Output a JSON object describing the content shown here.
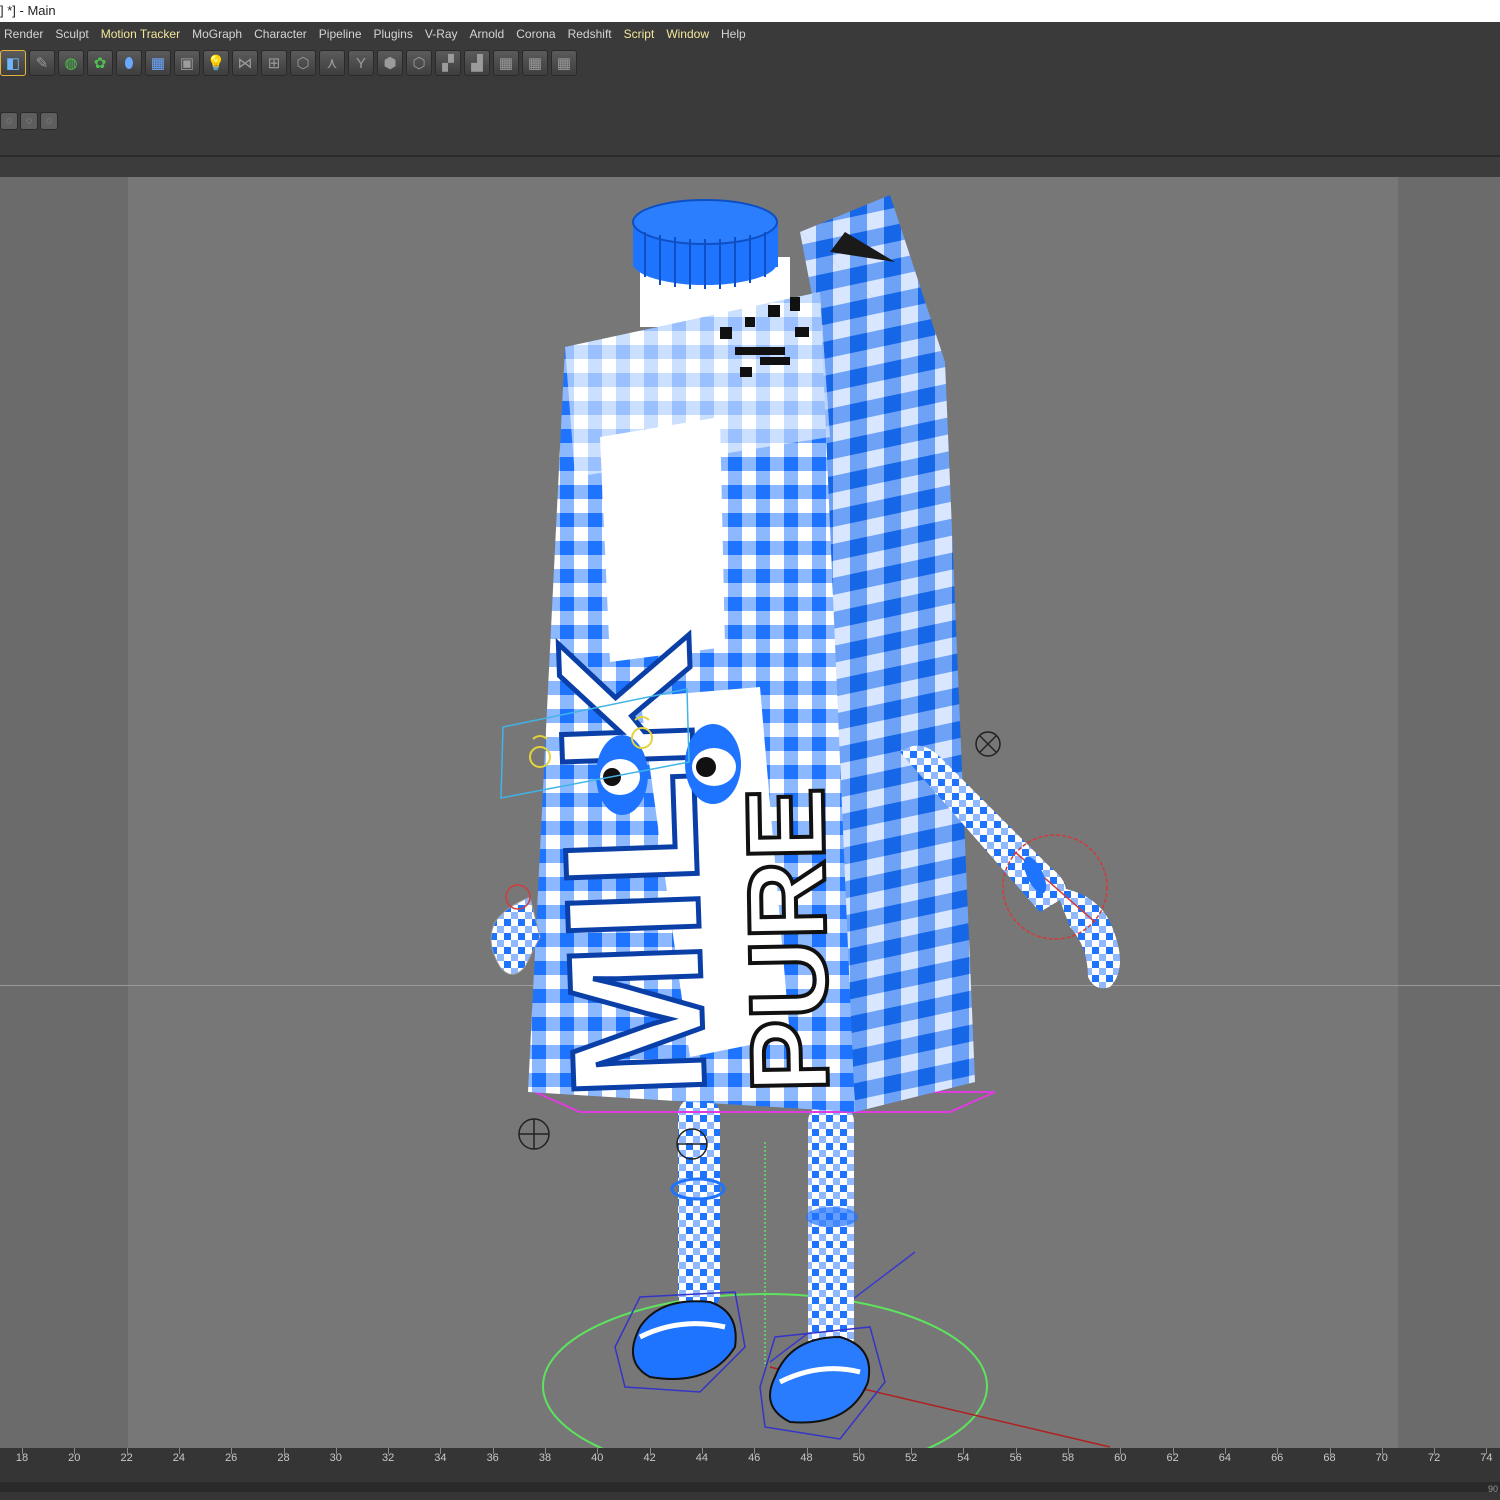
{
  "window": {
    "title": "] *] - Main"
  },
  "menubar": {
    "items": [
      {
        "label": "Render",
        "highlight": false
      },
      {
        "label": "Sculpt",
        "highlight": false
      },
      {
        "label": "Motion Tracker",
        "highlight": true
      },
      {
        "label": "MoGraph",
        "highlight": false
      },
      {
        "label": "Character",
        "highlight": false
      },
      {
        "label": "Pipeline",
        "highlight": false
      },
      {
        "label": "Plugins",
        "highlight": false
      },
      {
        "label": "V-Ray",
        "highlight": false
      },
      {
        "label": "Arnold",
        "highlight": false
      },
      {
        "label": "Corona",
        "highlight": false
      },
      {
        "label": "Redshift",
        "highlight": false
      },
      {
        "label": "Script",
        "highlight": true
      },
      {
        "label": "Window",
        "highlight": true
      },
      {
        "label": "Help",
        "highlight": false
      }
    ]
  },
  "toolbar": {
    "icons": [
      "cube-icon",
      "pen-icon",
      "subdivision-icon",
      "cloner-icon",
      "deformer-icon",
      "floor-icon",
      "camera-icon",
      "light-icon",
      "joint-icon",
      "ik-icon",
      "null-icon",
      "bone-icon",
      "pose-icon",
      "skin-icon",
      "cluster-icon",
      "weight-icon",
      "rig-icon",
      "grid-icon",
      "array-icon",
      "matrix-icon"
    ],
    "small_icons": [
      "snap-icon",
      "lock-icon",
      "magnet-icon"
    ]
  },
  "viewport": {
    "label_text": {
      "front": "MILK",
      "side": "PURE"
    }
  },
  "timeline": {
    "ticks": [
      "18",
      "20",
      "22",
      "24",
      "26",
      "28",
      "30",
      "32",
      "34",
      "36",
      "38",
      "40",
      "42",
      "44",
      "46",
      "48",
      "50",
      "52",
      "54",
      "56",
      "58",
      "60",
      "62",
      "64",
      "66",
      "68",
      "70",
      "72",
      "74"
    ],
    "end_label": "90"
  },
  "colors": {
    "carton_blue": "#1f74ff",
    "carton_white": "#ffffff",
    "menu_highlight": "#f3e79b"
  }
}
